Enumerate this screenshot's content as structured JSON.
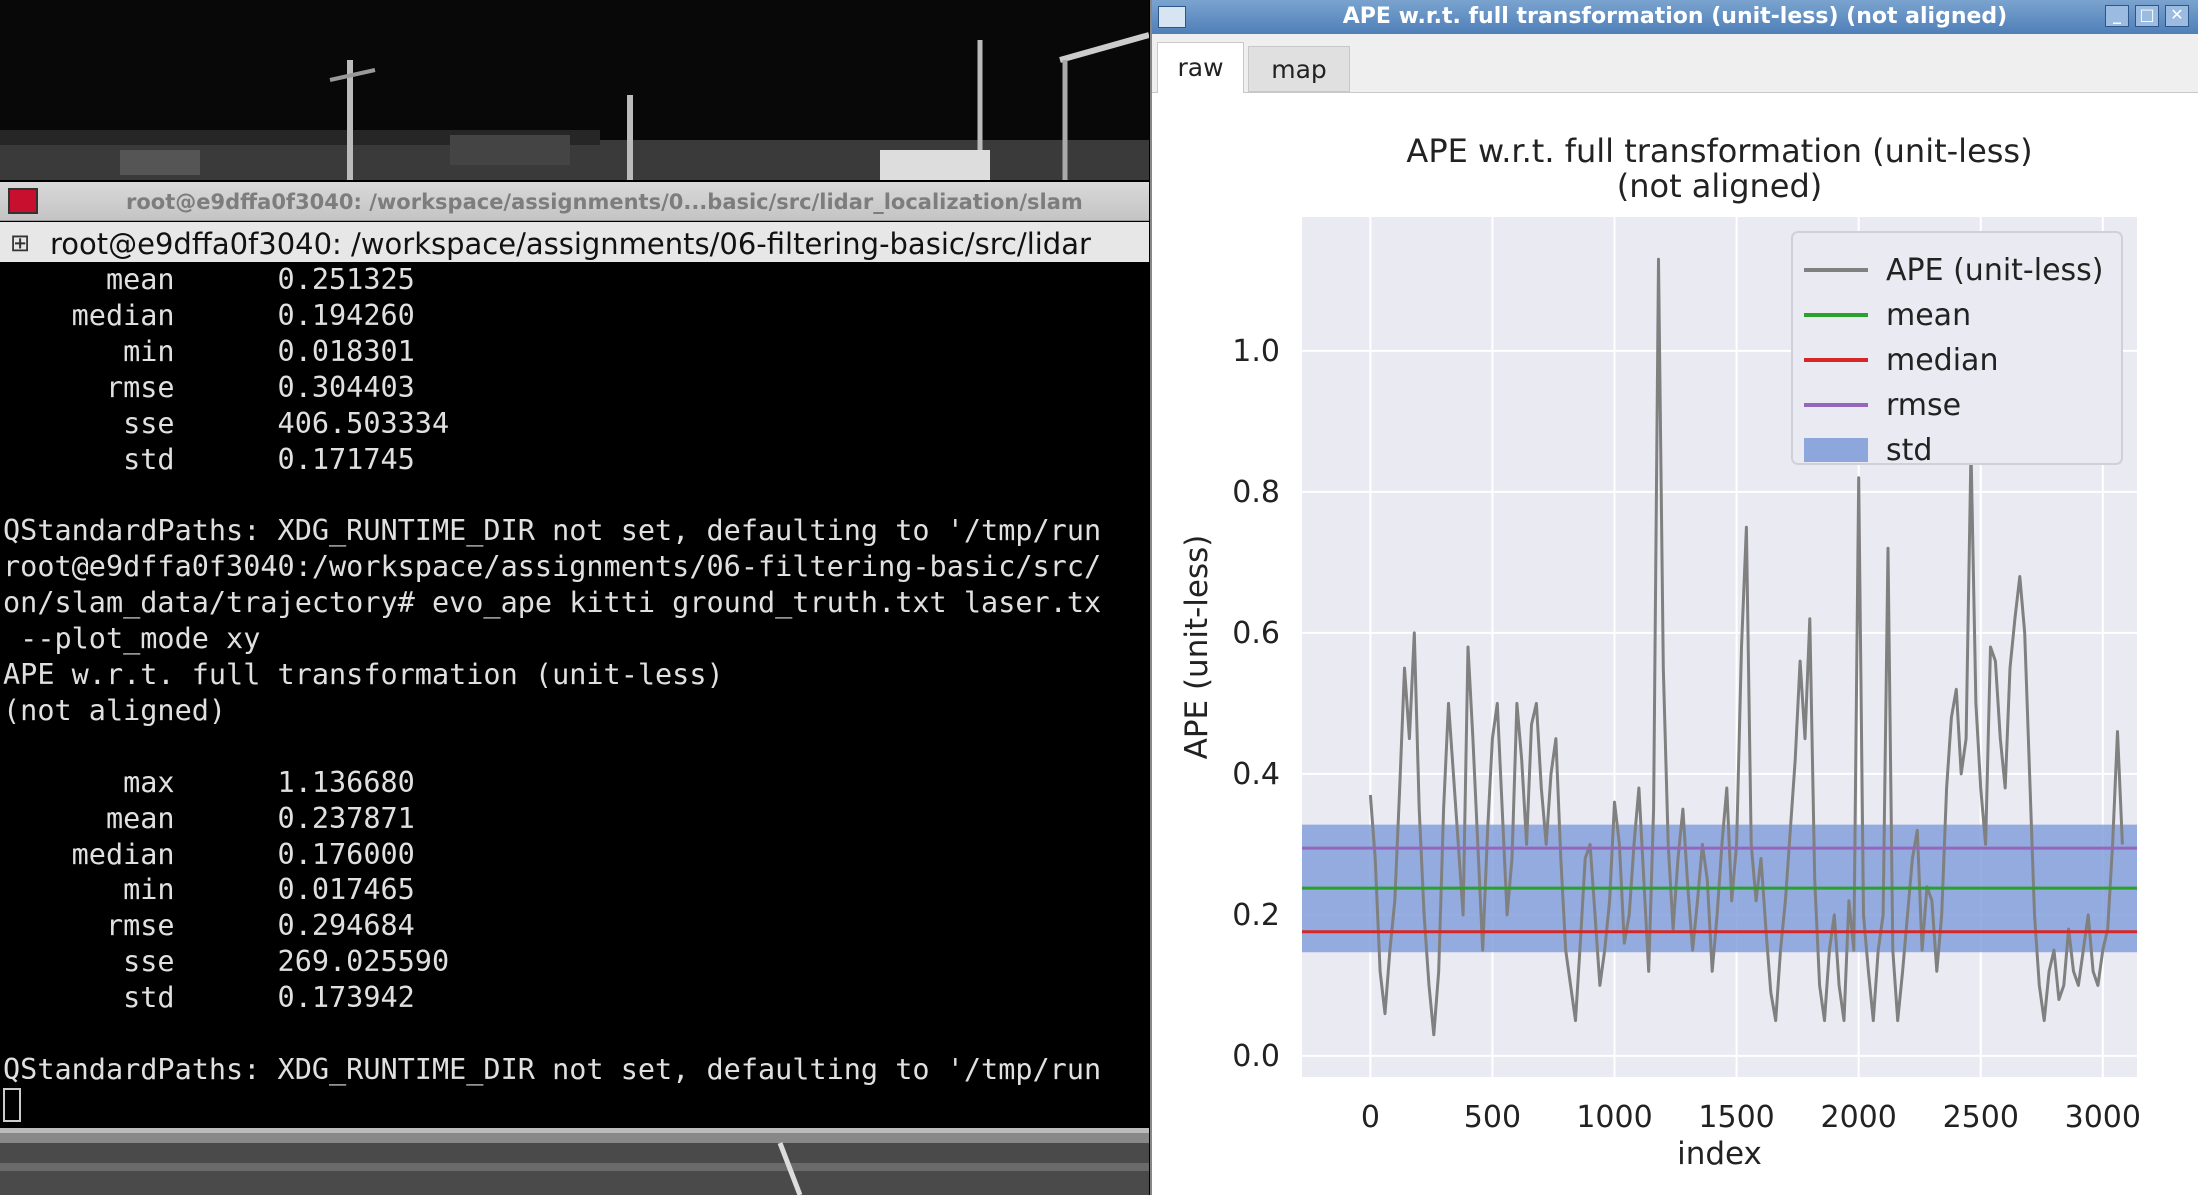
{
  "background_window": {
    "title": "root@e9dffa0f3040: /workspace/assignments/0...basic/src/lidar_localization/slam"
  },
  "terminal": {
    "title": "root@e9dffa0f3040: /workspace/assignments/06-filtering-basic/src/lidar",
    "lines": [
      "      mean      0.251325",
      "    median      0.194260",
      "       min      0.018301",
      "      rmse      0.304403",
      "       sse      406.503334",
      "       std      0.171745",
      "",
      "QStandardPaths: XDG_RUNTIME_DIR not set, defaulting to '/tmp/run",
      "root@e9dffa0f3040:/workspace/assignments/06-filtering-basic/src/",
      "on/slam_data/trajectory# evo_ape kitti ground_truth.txt laser.tx",
      " --plot_mode xy",
      "APE w.r.t. full transformation (unit-less)",
      "(not aligned)",
      "",
      "       max      1.136680",
      "      mean      0.237871",
      "    median      0.176000",
      "       min      0.017465",
      "      rmse      0.294684",
      "       sse      269.025590",
      "       std      0.173942",
      "",
      "QStandardPaths: XDG_RUNTIME_DIR not set, defaulting to '/tmp/run"
    ]
  },
  "plot_window": {
    "title": "APE w.r.t. full transformation (unit-less) (not aligned)",
    "tabs": [
      {
        "label": "raw",
        "active": true
      },
      {
        "label": "map",
        "active": false
      }
    ],
    "minimize_glyph": "_",
    "maximize_glyph": "□",
    "close_glyph": "✕"
  },
  "colors": {
    "ape_line": "#808080",
    "mean": "#2ca02c",
    "median": "#d62728",
    "rmse": "#9467bd",
    "std_band": "#7d9bd8",
    "plot_bg": "#eaeaf2"
  },
  "chart_data": {
    "type": "line",
    "title": "APE w.r.t. full transformation (unit-less)\n(not aligned)",
    "xlabel": "index",
    "ylabel": "APE (unit-less)",
    "xlim": [
      -280,
      3140
    ],
    "ylim": [
      -0.03,
      1.19
    ],
    "xticks": [
      0,
      500,
      1000,
      1500,
      2000,
      2500,
      3000
    ],
    "yticks": [
      0.0,
      0.2,
      0.4,
      0.6,
      0.8,
      1.0
    ],
    "grid": true,
    "legend_position": "top-right",
    "legend": [
      "APE (unit-less)",
      "mean",
      "median",
      "rmse",
      "std"
    ],
    "series": [
      {
        "name": "APE (unit-less)",
        "x": [
          0,
          20,
          40,
          60,
          80,
          100,
          120,
          140,
          160,
          180,
          200,
          220,
          240,
          260,
          280,
          300,
          320,
          340,
          360,
          380,
          400,
          420,
          440,
          460,
          480,
          500,
          520,
          540,
          560,
          580,
          600,
          620,
          640,
          660,
          680,
          700,
          720,
          740,
          760,
          780,
          800,
          820,
          840,
          860,
          880,
          900,
          920,
          940,
          960,
          980,
          1000,
          1020,
          1040,
          1060,
          1080,
          1100,
          1120,
          1140,
          1160,
          1180,
          1200,
          1220,
          1240,
          1260,
          1280,
          1300,
          1320,
          1340,
          1360,
          1380,
          1400,
          1420,
          1440,
          1460,
          1480,
          1500,
          1520,
          1540,
          1560,
          1580,
          1600,
          1620,
          1640,
          1660,
          1680,
          1700,
          1720,
          1740,
          1760,
          1780,
          1800,
          1820,
          1840,
          1860,
          1880,
          1900,
          1920,
          1940,
          1960,
          1980,
          2000,
          2020,
          2040,
          2060,
          2080,
          2100,
          2120,
          2140,
          2160,
          2180,
          2200,
          2220,
          2240,
          2260,
          2280,
          2300,
          2320,
          2340,
          2360,
          2380,
          2400,
          2420,
          2440,
          2460,
          2480,
          2500,
          2520,
          2540,
          2560,
          2580,
          2600,
          2620,
          2640,
          2660,
          2680,
          2700,
          2720,
          2740,
          2760,
          2780,
          2800,
          2820,
          2840,
          2860,
          2880,
          2900,
          2920,
          2940,
          2960,
          2980,
          3000,
          3020,
          3040,
          3060,
          3080
        ],
        "y": [
          0.37,
          0.28,
          0.12,
          0.06,
          0.15,
          0.22,
          0.38,
          0.55,
          0.45,
          0.6,
          0.35,
          0.2,
          0.1,
          0.03,
          0.12,
          0.35,
          0.5,
          0.4,
          0.3,
          0.2,
          0.58,
          0.45,
          0.3,
          0.15,
          0.32,
          0.45,
          0.5,
          0.35,
          0.2,
          0.28,
          0.5,
          0.42,
          0.3,
          0.47,
          0.5,
          0.38,
          0.3,
          0.4,
          0.45,
          0.28,
          0.15,
          0.1,
          0.05,
          0.16,
          0.28,
          0.3,
          0.2,
          0.1,
          0.15,
          0.22,
          0.36,
          0.3,
          0.16,
          0.2,
          0.3,
          0.38,
          0.25,
          0.12,
          0.35,
          1.13,
          0.55,
          0.3,
          0.18,
          0.28,
          0.35,
          0.24,
          0.15,
          0.22,
          0.3,
          0.25,
          0.12,
          0.2,
          0.3,
          0.38,
          0.22,
          0.3,
          0.58,
          0.75,
          0.3,
          0.22,
          0.28,
          0.18,
          0.09,
          0.05,
          0.15,
          0.22,
          0.32,
          0.42,
          0.56,
          0.45,
          0.62,
          0.25,
          0.1,
          0.05,
          0.15,
          0.2,
          0.1,
          0.05,
          0.22,
          0.15,
          0.82,
          0.2,
          0.12,
          0.05,
          0.15,
          0.2,
          0.72,
          0.15,
          0.05,
          0.12,
          0.2,
          0.28,
          0.32,
          0.15,
          0.24,
          0.22,
          0.12,
          0.2,
          0.38,
          0.48,
          0.52,
          0.4,
          0.45,
          0.86,
          0.5,
          0.38,
          0.3,
          0.58,
          0.56,
          0.45,
          0.38,
          0.55,
          0.62,
          0.68,
          0.6,
          0.4,
          0.2,
          0.1,
          0.05,
          0.12,
          0.15,
          0.08,
          0.1,
          0.18,
          0.12,
          0.1,
          0.15,
          0.2,
          0.12,
          0.1,
          0.15,
          0.18,
          0.3,
          0.46,
          0.3
        ]
      },
      {
        "name": "mean",
        "value": 0.237871
      },
      {
        "name": "median",
        "value": 0.176
      },
      {
        "name": "rmse",
        "value": 0.294684
      },
      {
        "name": "std",
        "band": [
          0.147,
          0.328
        ]
      }
    ]
  }
}
